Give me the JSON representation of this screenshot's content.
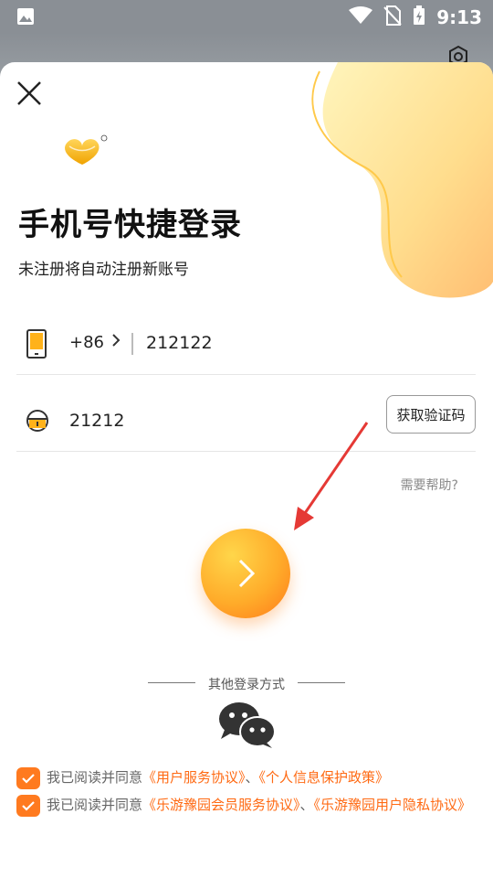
{
  "status_bar": {
    "time": "9:13"
  },
  "login": {
    "title": "手机号快捷登录",
    "subtitle": "未注册将自动注册新账号",
    "country_code": "+86",
    "phone_value": "212122",
    "code_value": "21212",
    "get_code_label": "获取验证码",
    "help_label": "需要帮助?",
    "other_login_label": "其他登录方式"
  },
  "agreements": [
    {
      "prefix": "我已阅读并同意",
      "link1": "《用户服务协议》",
      "sep": "、",
      "link2": "《个人信息保护政策》",
      "checked": true
    },
    {
      "prefix": "我已阅读并同意",
      "link1": "《乐游豫园会员服务协议》",
      "sep": "、",
      "link2": "《乐游豫园用户隐私协议》",
      "checked": true
    }
  ],
  "colors": {
    "accent": "#ff7a1f",
    "link": "#ff6a13",
    "button_gradient_start": "#ffd64a",
    "button_gradient_end": "#ff7a1a"
  },
  "icons": [
    "image-icon",
    "wifi-icon",
    "no-sim-icon",
    "battery-icon",
    "settings-icon",
    "close-icon",
    "phone-icon",
    "lock-icon",
    "chevron-right-icon",
    "wechat-icon",
    "checkmark-icon"
  ]
}
